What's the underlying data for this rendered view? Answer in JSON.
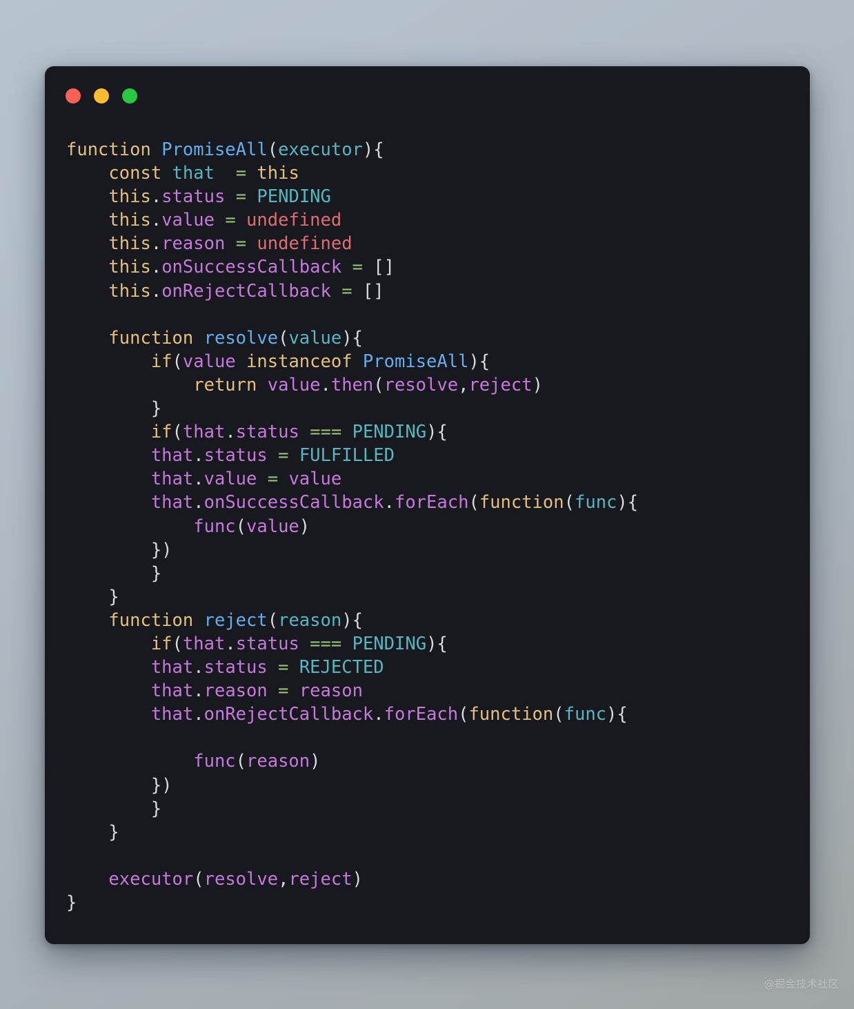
{
  "window": {
    "controls": [
      {
        "name": "close",
        "label": "close-button",
        "color": "#fe5f57"
      },
      {
        "name": "minimize",
        "label": "minimize-button",
        "color": "#febc2e"
      },
      {
        "name": "maximize",
        "label": "maximize-button",
        "color": "#28c840"
      }
    ],
    "background": "#17191e"
  },
  "theme": {
    "page_gradient_from": "#b7c3cf",
    "page_gradient_to": "#a0a5a6",
    "keyword": "#e5c07b",
    "class_name": "#61afef",
    "property": "#c678dd",
    "operator": "#98c379",
    "constant": "#56b6c2",
    "error": "#e06c75",
    "punctuation": "#d7dae0"
  },
  "code": {
    "language": "javascript",
    "title": "PromiseAll implementation",
    "lines": [
      "function PromiseAll(executor){",
      "    const that  = this",
      "    this.status = PENDING",
      "    this.value = undefined",
      "    this.reason = undefined",
      "    this.onSuccessCallback = []",
      "    this.onRejectCallback = []",
      "",
      "    function resolve(value){",
      "        if(value instanceof PromiseAll){",
      "            return value.then(resolve,reject)",
      "        }",
      "        if(that.status === PENDING){",
      "        that.status = FULFILLED",
      "        that.value = value",
      "        that.onSuccessCallback.forEach(function(func){",
      "            func(value)",
      "        })",
      "        }",
      "    }",
      "    function reject(reason){",
      "        if(that.status === PENDING){",
      "        that.status = REJECTED",
      "        that.reason = reason",
      "        that.onRejectCallback.forEach(function(func){",
      "",
      "            func(reason)",
      "        })",
      "        }",
      "    }",
      "",
      "    executor(resolve,reject)",
      "}"
    ]
  },
  "watermark": {
    "text": "@掘金技术社区"
  }
}
